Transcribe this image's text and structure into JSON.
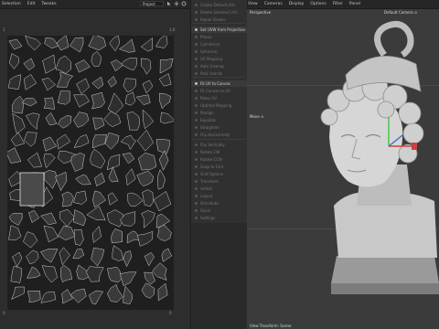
{
  "menubar": {
    "left_items": [
      "Selection",
      "Edit",
      "Tweaks"
    ],
    "project_select": "Project",
    "right_items": [
      "View",
      "Cameras",
      "Display",
      "Options",
      "Filter",
      "Panel"
    ]
  },
  "uv_editor": {
    "tick_top_left": "1",
    "tick_top_right": "1.0",
    "tick_bottom_left": "0",
    "tick_bottom_right": "0"
  },
  "tool_panel": {
    "items": [
      {
        "label": "Create Default UVs",
        "active": false
      },
      {
        "label": "Delete Selected UVs",
        "active": false
      },
      {
        "label": "Repair Broken",
        "active": false
      },
      {
        "label": "Set UVW from Projection",
        "active": true
      },
      {
        "label": "Planar",
        "active": false
      },
      {
        "label": "Cylindrical",
        "active": false
      },
      {
        "label": "Spherical",
        "active": false
      },
      {
        "label": "UV Mapping",
        "active": false
      },
      {
        "label": "Auto Unwrap",
        "active": false
      },
      {
        "label": "Pack Islands",
        "active": false
      },
      {
        "label": "Fit UV to Canvas",
        "active": true
      },
      {
        "label": "Fit Canvas to UV",
        "active": false
      },
      {
        "label": "Relax UV",
        "active": false
      },
      {
        "label": "Optimal Mapping",
        "active": false
      },
      {
        "label": "Realign",
        "active": false
      },
      {
        "label": "Equalize",
        "active": false
      },
      {
        "label": "Straighten",
        "active": false
      },
      {
        "label": "Flip Horizontally",
        "active": false
      },
      {
        "label": "Flip Vertically",
        "active": false
      },
      {
        "label": "Rotate CW",
        "active": false
      },
      {
        "label": "Rotate CCW",
        "active": false
      },
      {
        "label": "Snap to Grid",
        "active": false
      },
      {
        "label": "Grid Options",
        "active": false
      },
      {
        "label": "Transform",
        "active": false
      },
      {
        "label": "Unfold",
        "active": false
      },
      {
        "label": "Layout",
        "active": false
      },
      {
        "label": "Distribute",
        "active": false
      },
      {
        "label": "Stack",
        "active": false
      },
      {
        "label": "Settings",
        "active": false
      }
    ]
  },
  "viewport": {
    "projection_label": "Perspective",
    "camera_label": "Default Camera ⊙",
    "move_label": "Move ⊙",
    "status_label": "View Transform: Scene"
  },
  "colors": {
    "bg": "#2b2b2b",
    "viewport_bg": "#3b3b3b",
    "uv_lines": "#cfcfcf",
    "axis_x": "#d04040",
    "axis_y": "#3cc83c",
    "axis_z": "#3c6cd0"
  },
  "icons": [
    "pointer-icon",
    "move-icon",
    "rotate-icon",
    "scale-icon",
    "axis-gizmo-icon"
  ]
}
